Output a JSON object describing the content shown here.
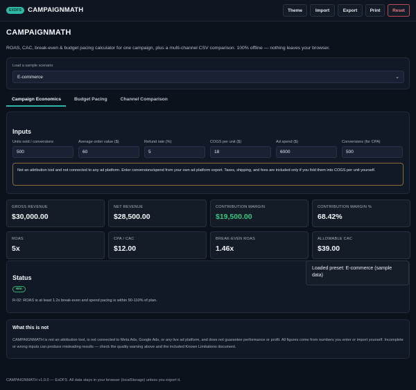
{
  "topbar": {
    "badge": "EXDFS",
    "brand": "CAMPAIGNMATH",
    "buttons": {
      "theme": "Theme",
      "import": "Import",
      "export": "Export",
      "print": "Print",
      "reset": "Reset"
    }
  },
  "page": {
    "title": "CAMPAIGNMATH",
    "subtitle": "ROAS, CAC, break-even & budget pacing calculator for one campaign, plus a multi-channel CSV comparison. 100% offline — nothing leaves your browser."
  },
  "scenario": {
    "label": "Load a sample scenario",
    "selected": "E-commerce"
  },
  "tabs": [
    "Campaign Economics",
    "Budget Pacing",
    "Channel Comparison"
  ],
  "inputs": {
    "title": "Inputs",
    "fields": [
      {
        "label": "Units sold / conversions",
        "value": "500"
      },
      {
        "label": "Average order value ($)",
        "value": "60"
      },
      {
        "label": "Refund rate (%)",
        "value": "5"
      },
      {
        "label": "COGS per unit ($)",
        "value": "18"
      },
      {
        "label": "Ad spend ($)",
        "value": "6000"
      },
      {
        "label": "Conversions (for CPA)",
        "value": "500"
      }
    ],
    "notice": "Not an attribution tool and not connected to any ad platform. Enter conversions/spend from your own ad platform export. Taxes, shipping, and fees are included only if you fold them into COGS per unit yourself."
  },
  "kpis": [
    {
      "label": "Gross revenue",
      "value": "$30,000.00"
    },
    {
      "label": "Net revenue",
      "value": "$28,500.00"
    },
    {
      "label": "Contribution margin",
      "value": "$19,500.00"
    },
    {
      "label": "Contribution margin %",
      "value": "68.42%"
    },
    {
      "label": "ROAS",
      "value": "5x"
    },
    {
      "label": "CPA / CAC",
      "value": "$12.00"
    },
    {
      "label": "Break-even ROAS",
      "value": "1.46x"
    },
    {
      "label": "Allowable CAC",
      "value": "$39.00"
    }
  ],
  "colors": {
    "accent": "#2fb8a5",
    "positive": "#35c77f",
    "danger": "#c44a55",
    "warning": "#8a6f2f"
  },
  "status": {
    "title": "Status",
    "badge": "Win",
    "text": "R-02: ROAS is at least 1.2x break-even and spend pacing is within 90-110% of plan."
  },
  "toast": "Loaded preset: E-commerce (sample data)",
  "not_section": {
    "title": "What this is not",
    "text": "CAMPAIGNMATH is not an attribution tool, is not connected to Meta Ads, Google Ads, or any live ad platform, and does not guarantee performance or profit. All figures come from numbers you enter or import yourself. Incomplete or wrong inputs can produce misleading results — check the quality warning above and the included Known Limitations document."
  },
  "footer": "CAMPAIGNMATH v1.0.0 — ExDFS. All data stays in your browser (localStorage) unless you export it."
}
